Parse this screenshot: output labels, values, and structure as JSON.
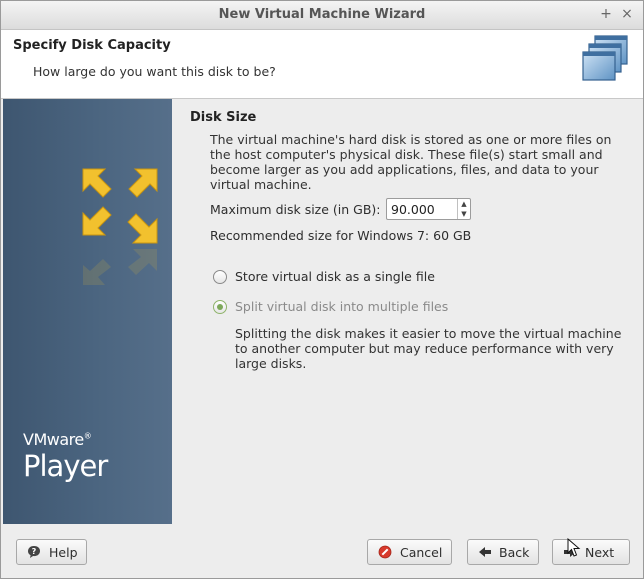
{
  "window": {
    "title": "New Virtual Machine Wizard"
  },
  "titlebar": {
    "maximize_glyph": "+",
    "close_glyph": "×"
  },
  "header": {
    "title": "Specify Disk Capacity",
    "subtitle": "How large do you want this disk to be?",
    "icon": "stacked-windows-icon"
  },
  "sidebar": {
    "brand": "VMware",
    "brand_mark": "®",
    "product": "Player",
    "logo_icon": "vmware-arrows-icon"
  },
  "disk": {
    "section_title": "Disk Size",
    "description": "The virtual machine's hard disk is stored as one or more files on the host computer's physical disk. These file(s) start small and become larger as you add applications, files, and data to your virtual machine.",
    "max_size_label": "Maximum disk size (in GB):",
    "max_size_value": "90.000",
    "recommended": "Recommended size for Windows 7: 60 GB"
  },
  "options": {
    "single_label": "Store virtual disk as a single file",
    "split_label": "Split virtual disk into multiple files",
    "selected": "split",
    "split_description": "Splitting the disk makes it easier to move the virtual machine to another computer but may reduce performance with very large disks."
  },
  "footer": {
    "help_label": "Help",
    "cancel_label": "Cancel",
    "back_label": "Back",
    "next_label": "Next"
  },
  "colors": {
    "sidebar": "#4b6580",
    "logo": "#f2c12e",
    "radio_selected": "#7da85a"
  }
}
